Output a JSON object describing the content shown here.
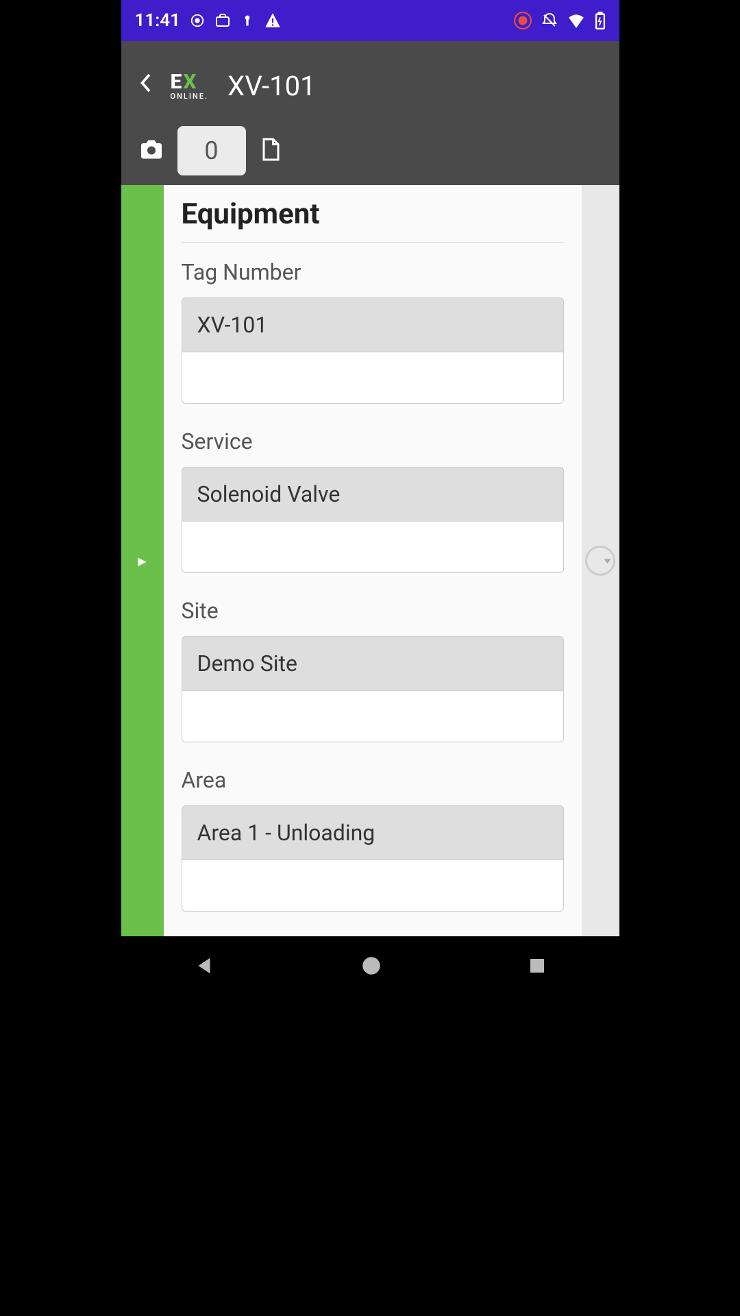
{
  "status": {
    "time": "11:41"
  },
  "header": {
    "logo_top_e": "E",
    "logo_top_x": "X",
    "logo_bottom": "ONLINE.",
    "title": "XV-101",
    "counter": "0"
  },
  "form": {
    "section_title": "Equipment",
    "fields": {
      "tag": {
        "label": "Tag Number",
        "value": "XV-101",
        "input": ""
      },
      "service": {
        "label": "Service",
        "value": "Solenoid Valve",
        "input": ""
      },
      "site": {
        "label": "Site",
        "value": "Demo Site",
        "input": ""
      },
      "area": {
        "label": "Area",
        "value": "Area 1 - Unloading",
        "input": ""
      }
    }
  }
}
